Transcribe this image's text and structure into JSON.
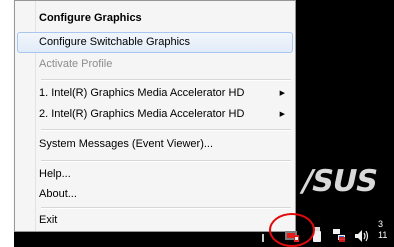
{
  "menu": {
    "items": [
      {
        "label": "Configure Graphics",
        "state": "bold"
      },
      {
        "label": "Configure Switchable Graphics",
        "state": "hover"
      },
      {
        "label": "Activate Profile",
        "state": "disabled"
      },
      {
        "label": "1. Intel(R) Graphics Media Accelerator HD",
        "state": "submenu"
      },
      {
        "label": "2. Intel(R) Graphics Media Accelerator HD",
        "state": "submenu"
      },
      {
        "label": "System Messages (Event Viewer)...",
        "state": "normal"
      },
      {
        "label": "Help...",
        "state": "normal"
      },
      {
        "label": "About...",
        "state": "normal"
      },
      {
        "label": "Exit",
        "state": "normal"
      }
    ],
    "submenu_arrow": "▶"
  },
  "desktop": {
    "logo_text": "/SUS"
  },
  "tray": {
    "icons": [
      "intel-graphics-icon",
      "usb-safely-remove-icon",
      "network-icon",
      "volume-icon"
    ],
    "clock_line1": "3",
    "clock_line2": "11",
    "highlight_color": "#e10a0a"
  }
}
